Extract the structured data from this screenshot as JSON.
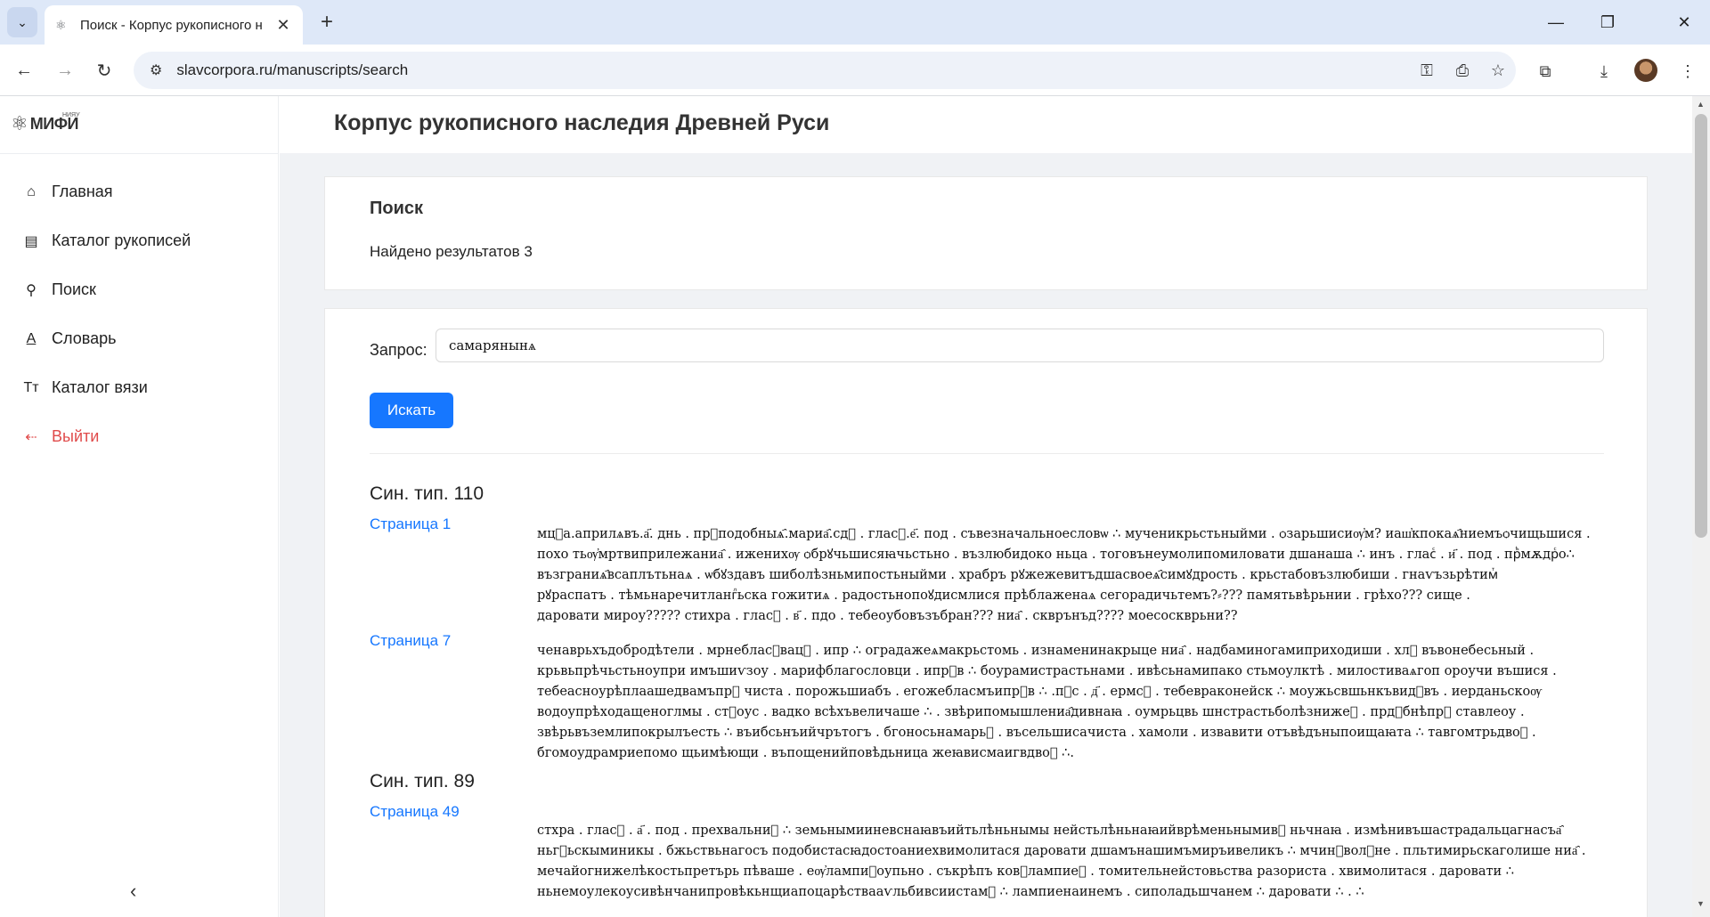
{
  "browser": {
    "tab_title": "Поиск - Корпус рукописного н",
    "url": "slavcorpora.ru/manuscripts/search"
  },
  "sidebar": {
    "logo": "МИФИ",
    "logo_sup": "НИЯУ",
    "items": [
      {
        "label": "Главная",
        "icon": "home-icon"
      },
      {
        "label": "Каталог рукописей",
        "icon": "book-icon"
      },
      {
        "label": "Поиск",
        "icon": "search-icon"
      },
      {
        "label": "Словарь",
        "icon": "dictionary-icon"
      },
      {
        "label": "Каталог вязи",
        "icon": "font-icon"
      },
      {
        "label": "Выйти",
        "icon": "logout-icon"
      }
    ]
  },
  "header": {
    "title": "Корпус рукописного наследия Древней Руси"
  },
  "search_summary": {
    "heading": "Поиск",
    "found": "Найдено результатов 3"
  },
  "query": {
    "label": "Запрос:",
    "value": "самарянынѧ",
    "button": "Искать"
  },
  "results": [
    {
      "title": "Син. тип. 110",
      "pages": [
        {
          "link": "Страница 1",
          "lines": [
            "мцⷭа.априлѧвъ.а҃. днь . прⷺподобныѧ҄.мариа҄.сдⷷ . гласⷭ.е҃. под . съвезначальноесловѡ ∴ мученикрьстьныйми . ѻзарьшисиѹ҆м? иаш҆кпокаѧ҄ниемъѻчищьшися .",
            "похо тьѹ҆мртвиприлежаниа҄ . иженихѹ ѻбрꙋчьшисяꙗчьстьно . възлюбидоко ньца . тоговънеумолипомиловати дшанаша ∴ инъ . гласⷭ . и҃ . под . прⷺмѫдрⷭо∴",
            "възграниѧ҄всаплътьнаѧ . ѡбꙋздавъ шиболѣзньмипостьныйми . храбръ рꙋжежевитъдшасвоеѧ҄симꙋдрость . крьстабовъзлюбиши . гнаѵъзьрѣтимⷮ",
            "рꙋраспатъ . тѣмьнаречитлангⷧьска гожитиѧ . радостьнопоꙋдисмлися прѣблаженаѧ сегорадичьтемъ?⸗??? памятьвѣрьнии . грѣхо??? сище .",
            "даровати мироу????? стихра . гласⷭ . в҃ . пдо . тебеоубовъзъбран??? ниа҄ . скврънъд???? моесоскврьни??"
          ]
        },
        {
          "link": "Страница 7",
          "lines": [
            "ченаврьхъдобродѣтели . мрнебласⷭвацⷯ . ипр ∴ оградажеѧмакрьстомь . изнаменинакрыце ниа҄ . надбаминогамиприходиши . хлⷮ въвонебесьный .",
            "крьвьпрѣчьстьноупри имъшиѵзоу . марифблагословци . ипрⷺв ∴ боурамистрастьнами . ивѣсьнамипако стьмоулктѣ . милостиваѧгоп ороучи въшися .",
            "тебеасноурѣплаашедвамъпрⷺ чиста . порожьшиабъ . егожебласмъипрⷺв ∴ .пⷭс . д҃ . ермсⷪ . тебевраконейск ∴ моужьсвшьнкъвидⷮвъ . иерданьскоѹ",
            "водоупрѣходащеноглмы . стⷭоус . вадко всѣхъвеличаше ∴ . звѣрипомышлениа҄дивнаꙗ . оумрьцвь шнстрастьболѣзнижеⷦ . прдⷪбнѣпрⷺ ставлеоу .",
            "звѣрьвъземлипокрылъесть ∴ въибсьнъийчрътогъ . бгоносьнамарьⷷ . въсельшисачиста . хамоли . извавити отъвѣдъныпоищаꙗта ∴ тавгомтрьдвоⷦ .",
            "бгомоудрамриепомо щьимѣющи . въпощенийповѣдьница жеꙗвисмаигвдвоⷦ ∴."
          ]
        }
      ]
    },
    {
      "title": "Син. тип. 89",
      "pages": [
        {
          "link": "Страница 49",
          "lines": [
            "стхра . гласⷭ . а҃ . под . прехвальниⷮ ∴ земьнымииневснаꙗвъийтьлѣньнымы нейстьлѣньнаꙗийврѣменьнымивⷷ ньчнаꙗ . измѣнивъшастрадальцагнасъа҄",
            "ньгⷧьскыминикы . бжьствьнагосъ подобистасꙗдостоаниехвимолитася даровати дшамънашимъмиръивеликъ ∴ мчинⷭволⷺне . пльтимирьскаголише ниа҄ .",
            "мечайогнижелѣкостьпретърь пѣваше . еѹ҆лампиⷦоупьно . съкрѣпъ ковⷺлампиеⷦ . томительнейстовьства разориста . хвимолитася . даровати ∴",
            "ньнемоулекоусивѣнчанипровѣкьнщиапоцарѣствааѵльбивсиистамⷮ ∴ лампиенаинемъ . сиполадьшчанем ∴ даровати ∴ . ∴"
          ]
        }
      ]
    }
  ]
}
